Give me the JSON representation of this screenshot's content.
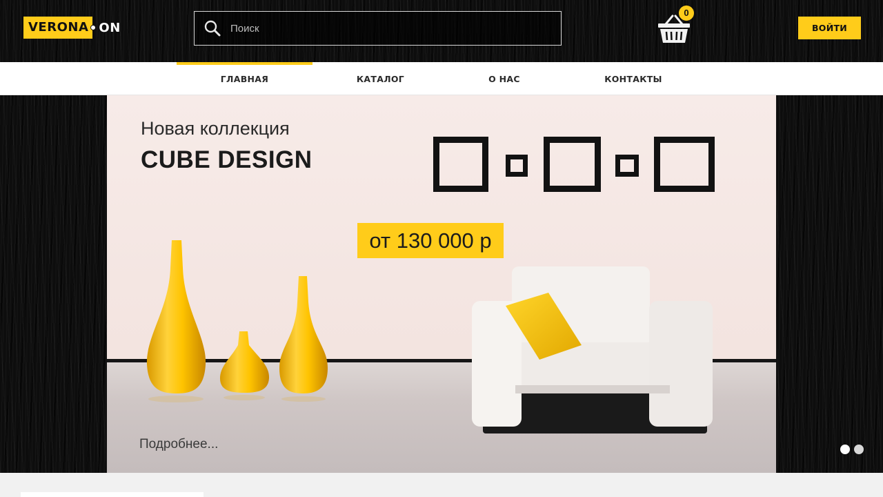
{
  "header": {
    "logo_left": "VERONA",
    "logo_right": "ON",
    "search_placeholder": "Поиск",
    "cart_count": "0",
    "login_label": "ВОЙТИ"
  },
  "nav": {
    "items": [
      {
        "label": "ГЛАВНАЯ",
        "active": true
      },
      {
        "label": "КАТАЛОГ",
        "active": false
      },
      {
        "label": "О НАС",
        "active": false
      },
      {
        "label": "КОНТАКТЫ",
        "active": false
      }
    ]
  },
  "hero": {
    "subtitle": "Новая коллекция",
    "title": "CUBE DESIGN",
    "price": "от 130 000 р",
    "more_link": "Подробнее...",
    "slides_total": 2,
    "active_slide": 1
  },
  "colors": {
    "accent": "#ffcc1a",
    "dark": "#0d0d0d",
    "wall": "#f7ebe8"
  },
  "icons": {
    "search": "search-icon",
    "cart": "basket-icon"
  }
}
